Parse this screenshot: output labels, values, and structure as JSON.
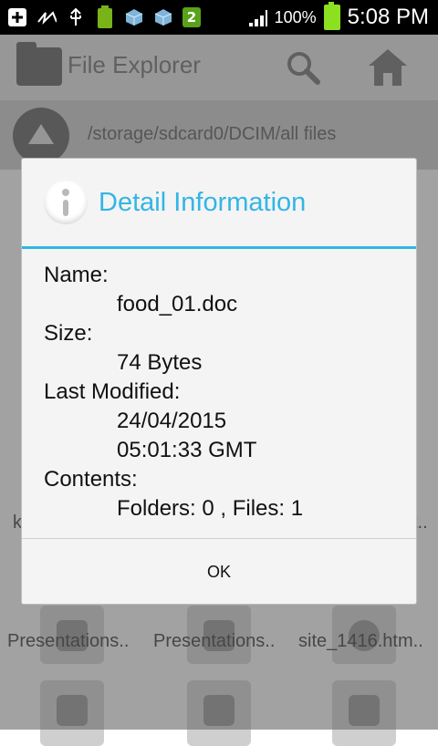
{
  "status_bar": {
    "battery_percent_text": "100%",
    "time": "5:08 PM",
    "notification_badge": "2",
    "icons": [
      "add-box-icon",
      "signature-icon",
      "usb-icon",
      "battery-100-icon",
      "cube-icon",
      "cube-icon",
      "signal-icon"
    ]
  },
  "header": {
    "title": "File Explorer",
    "icons": [
      "folder-icon",
      "search-icon",
      "home-icon"
    ]
  },
  "path_bar": {
    "path": "/storage/sdcard0/DCIM/all files"
  },
  "grid": {
    "visible_labels": [
      "Presentations..",
      "Presentations..",
      "site_1416.htm..",
      "k",
      "t.."
    ]
  },
  "dialog": {
    "title": "Detail Information",
    "labels": {
      "name": "Name:",
      "size": "Size:",
      "modified": "Last Modified:",
      "contents": "Contents:"
    },
    "values": {
      "name": "food_01.doc",
      "size": "74 Bytes",
      "modified_date": "24/04/2015",
      "modified_time": "05:01:33 GMT",
      "contents": "Folders: 0 , Files: 1"
    },
    "ok_label": "OK"
  },
  "colors": {
    "accent": "#33b5e5",
    "status_bar_bg": "#000000",
    "battery_green": "#8be020"
  }
}
